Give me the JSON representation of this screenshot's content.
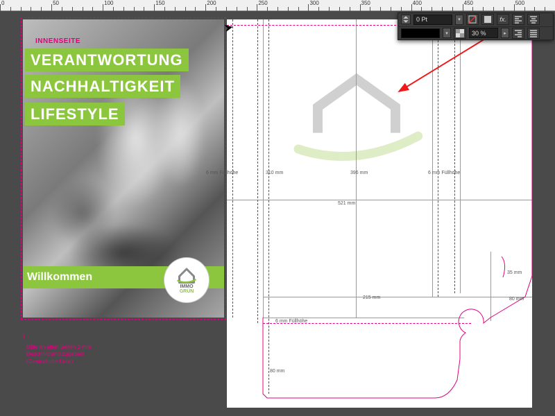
{
  "ruler": {
    "ticks": [
      0,
      50,
      100,
      150,
      200,
      250,
      300,
      350,
      400,
      450,
      500
    ]
  },
  "left_page": {
    "inner_label": "INNENSEITE",
    "kw1": "VERANTWORTUNG",
    "kw2": "NACHHALTIGKEIT",
    "kw3": "LIFESTYLE",
    "welcome": "Willkommen",
    "logo_line1": "IMMO",
    "logo_line2": "GRÜN"
  },
  "measurements": {
    "m310": "310 mm",
    "m396": "396 mm",
    "m521": "521 mm",
    "m215": "215 mm",
    "m80a": "80 mm",
    "m80b": "80 mm",
    "m35": "35 mm",
    "fill6a": "6 mm Füllhöhe",
    "fill6b": "6 mm Füllhöhe",
    "fill6c": "6 mm Füllhöhe"
  },
  "bleed_note": {
    "l1": "Bitte an allen Seiten 2 mm",
    "l2": "Beschnittrand zugeben!",
    "l3": "(Gestrichelte Linie)"
  },
  "panel": {
    "stroke_value": "0 Pt",
    "opacity_value": "30 %"
  },
  "colors": {
    "brand_green": "#8cc63f",
    "magenta": "#e4007f",
    "anno_red": "#f01818"
  }
}
